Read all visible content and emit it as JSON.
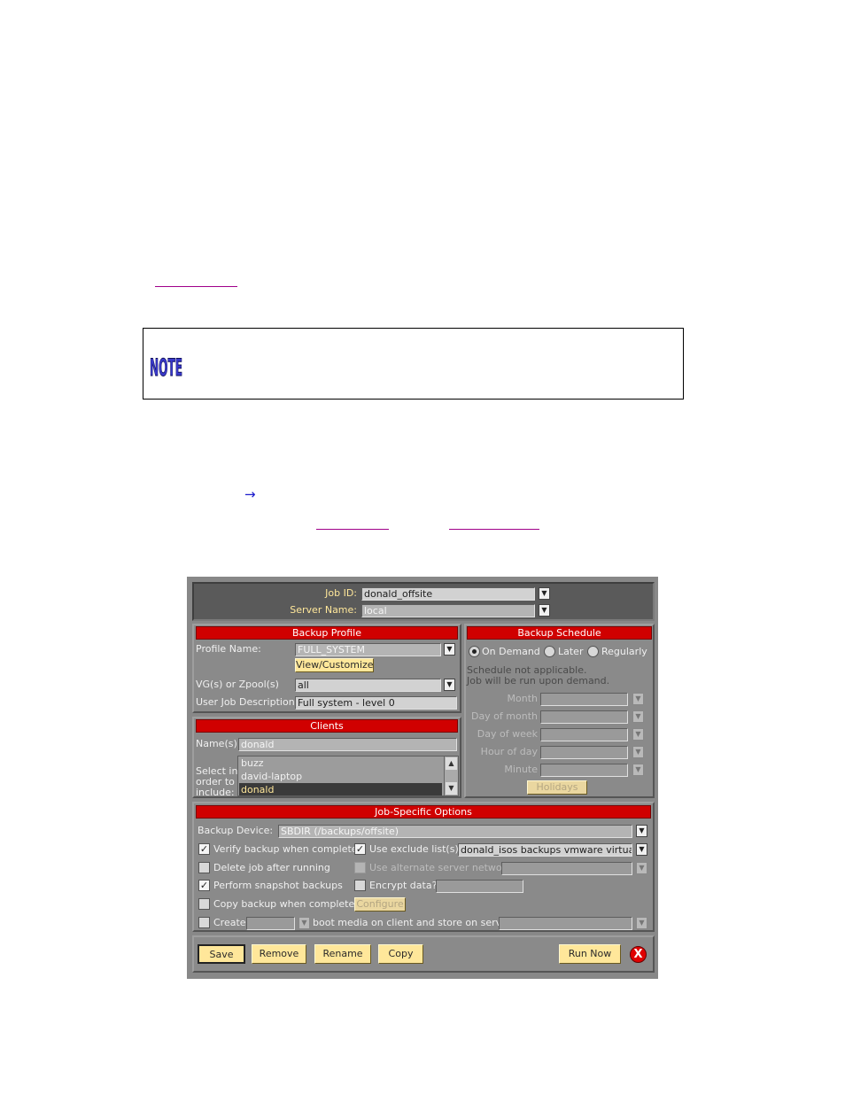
{
  "note": {
    "icon": "note-icon",
    "icon_text": "NOTE"
  },
  "arrow": {
    "icon": "arrow-right-icon",
    "glyph": "→"
  },
  "gui": {
    "job_id_label": "Job ID:",
    "job_id_value": "donald_offsite",
    "server_name_label": "Server Name:",
    "server_name_value": "local",
    "backup_profile": {
      "header": "Backup Profile",
      "profile_name_label": "Profile Name:",
      "profile_name_value": "FULL_SYSTEM",
      "view_customize": "View/Customize",
      "vg_label": "VG(s) or Zpool(s)",
      "vg_value": "all",
      "user_job_desc_label": "User Job Description:",
      "user_job_desc_value": "Full system - level 0"
    },
    "clients": {
      "header": "Clients",
      "names_label": "Name(s):",
      "names_value": "donald",
      "select_label_1": "Select in",
      "select_label_2": "order to",
      "select_label_3": "include:",
      "items": [
        "buzz",
        "david-laptop",
        "donald"
      ],
      "selected": "donald"
    },
    "backup_schedule": {
      "header": "Backup Schedule",
      "options": [
        "On Demand",
        "Later",
        "Regularly"
      ],
      "selected": "On Demand",
      "note_line1": "Schedule not applicable.",
      "note_line2": "Job will be run upon demand.",
      "month_label": "Month",
      "day_of_month_label": "Day of month",
      "day_of_week_label": "Day of week",
      "hour_of_day_label": "Hour of day",
      "minute_label": "Minute",
      "holidays": "Holidays"
    },
    "job_specific": {
      "header": "Job-Specific Options",
      "backup_device_label": "Backup Device:",
      "backup_device_value": "SBDIR (/backups/offsite)",
      "verify_label": "Verify backup when complete",
      "verify_checked": true,
      "use_exclude_label": "Use exclude list(s)",
      "use_exclude_checked": true,
      "exclude_value": "donald_isos backups vmware virtualb",
      "delete_job_label": "Delete job after running",
      "delete_job_checked": false,
      "alt_network_label": "Use alternate server network",
      "snapshot_label": "Perform snapshot backups",
      "snapshot_checked": true,
      "encrypt_label": "Encrypt data?",
      "encrypt_checked": false,
      "copy_backup_label": "Copy backup when complete:",
      "copy_backup_checked": false,
      "configure": "Configure",
      "create_label": "Create",
      "create_checked": false,
      "boot_media_label": "boot media on client and store on server"
    },
    "buttons": {
      "save": "Save",
      "remove": "Remove",
      "rename": "Rename",
      "copy": "Copy",
      "run_now": "Run Now",
      "close": "X"
    }
  }
}
